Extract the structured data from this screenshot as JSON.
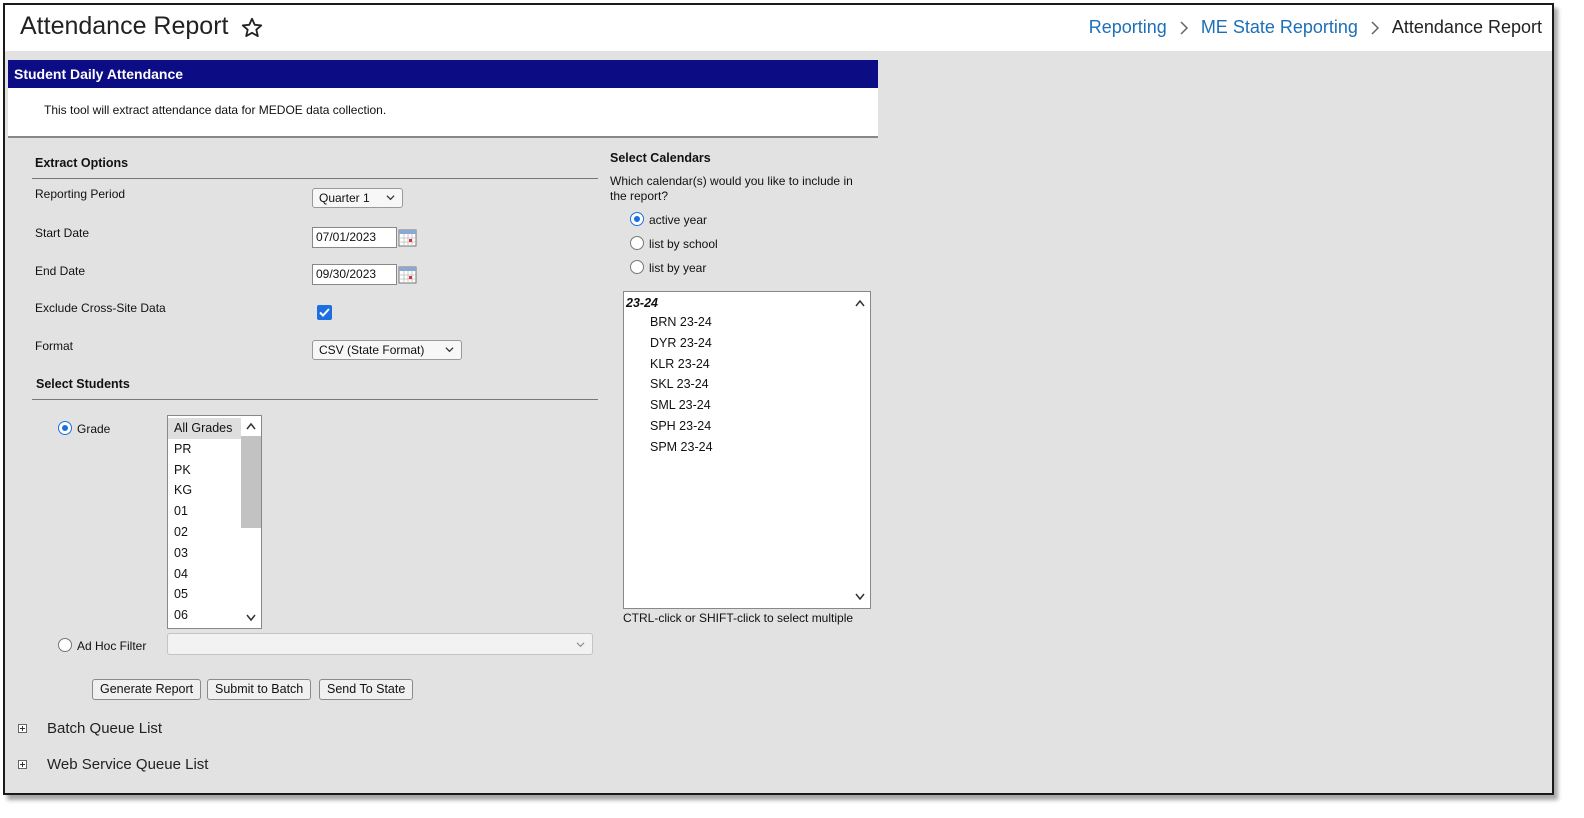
{
  "header": {
    "title": "Attendance Report",
    "breadcrumbs": [
      "Reporting",
      "ME State Reporting",
      "Attendance Report"
    ]
  },
  "panel": {
    "title": "Student Daily Attendance",
    "description": "This tool will extract attendance data for MEDOE data collection."
  },
  "extract_options": {
    "heading": "Extract Options",
    "reporting_period_label": "Reporting Period",
    "reporting_period_value": "Quarter 1",
    "start_date_label": "Start Date",
    "start_date_value": "07/01/2023",
    "end_date_label": "End Date",
    "end_date_value": "09/30/2023",
    "exclude_label": "Exclude Cross-Site Data",
    "exclude_checked": true,
    "format_label": "Format",
    "format_value": "CSV (State Format)"
  },
  "select_students": {
    "heading": "Select Students",
    "grade_label": "Grade",
    "grades": [
      "All Grades",
      "PR",
      "PK",
      "KG",
      "01",
      "02",
      "03",
      "04",
      "05",
      "06"
    ],
    "selected_grade": "All Grades",
    "adhoc_label": "Ad Hoc Filter"
  },
  "select_calendars": {
    "heading": "Select Calendars",
    "question": "Which calendar(s) would you like to include in the report?",
    "options": [
      "active year",
      "list by school",
      "list by year"
    ],
    "selected_option": "active year",
    "group": "23-24",
    "calendars": [
      "BRN 23-24",
      "DYR 23-24",
      "KLR 23-24",
      "SKL 23-24",
      "SML 23-24",
      "SPH 23-24",
      "SPM 23-24"
    ],
    "hint": "CTRL-click or SHIFT-click to select multiple"
  },
  "buttons": {
    "generate": "Generate Report",
    "submit_batch": "Submit to Batch",
    "send_state": "Send To State"
  },
  "queues": {
    "batch": "Batch Queue List",
    "web_service": "Web Service Queue List"
  },
  "colors": {
    "panel_header": "#0c0c84",
    "link": "#1c6fb8",
    "accent": "#1b6fe0",
    "background": "#e2e2e2"
  },
  "icons": [
    "star-icon",
    "chevron-right-icon",
    "chevron-down-icon",
    "calendar-icon",
    "checkbox-checked-icon",
    "expand-plus-icon"
  ]
}
